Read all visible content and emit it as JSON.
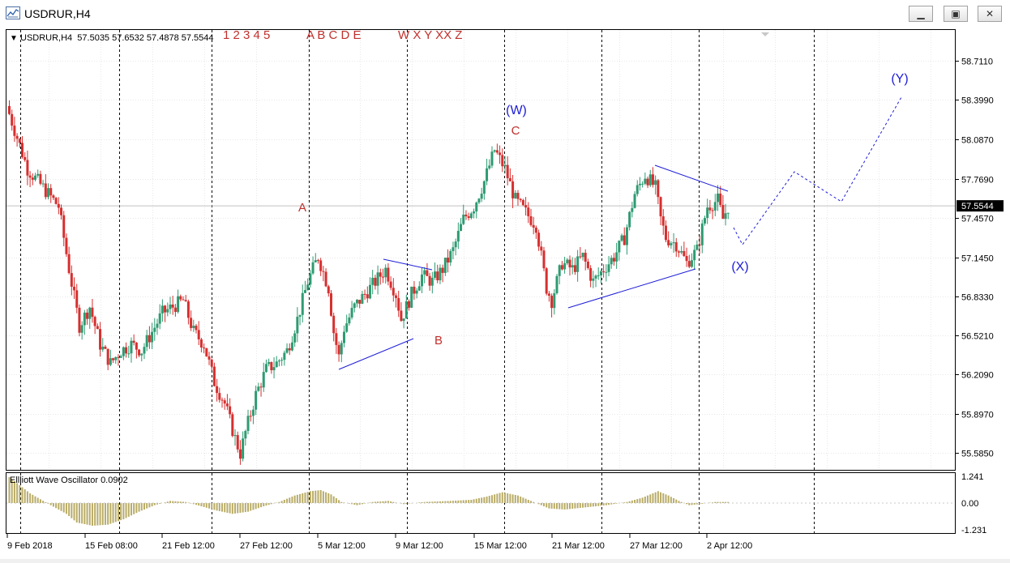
{
  "window": {
    "title": "USDRUR,H4",
    "icon": "chart-window-icon",
    "buttons": {
      "minimize": "minimize-icon",
      "restore": "restore-icon",
      "close": "close-icon"
    }
  },
  "chart_header": {
    "marker": "▼",
    "text": "USDRUR,H4  57.5035 57.6532 57.4878 57.5544"
  },
  "wave_toolbar": {
    "numbers": "1 2 3 4 5",
    "letters": "A B C D E",
    "combo": "W X Y XX Z"
  },
  "colors": {
    "bull": "#2e9b72",
    "bear": "#d62f2f",
    "wave_red": "#c0302c",
    "wave_blue": "#1c1cd8",
    "oscillator": "#b9ac66",
    "grid": "#c8c8c8"
  },
  "chart_data": {
    "type": "candlestick",
    "symbol": "USDRUR",
    "timeframe": "H4",
    "ylim": [
      55.45,
      58.95
    ],
    "y_ticks": [
      "58.7110",
      "58.3990",
      "58.0870",
      "57.7690",
      "57.4570",
      "57.1450",
      "56.8330",
      "56.5210",
      "56.2090",
      "55.8970",
      "55.5850"
    ],
    "current_price": "57.5544",
    "x_ticks": [
      "9 Feb 2018",
      "15 Feb 08:00",
      "21 Feb 12:00",
      "27 Feb 12:00",
      "5 Mar 12:00",
      "9 Mar 12:00",
      "15 Mar 12:00",
      "21 Mar 12:00",
      "27 Mar 12:00",
      "2 Apr 12:00"
    ],
    "close_path": [
      [
        0,
        58.35
      ],
      [
        4,
        58.1
      ],
      [
        8,
        57.85
      ],
      [
        12,
        57.75
      ],
      [
        16,
        57.65
      ],
      [
        20,
        57.55
      ],
      [
        24,
        57.05
      ],
      [
        28,
        56.6
      ],
      [
        32,
        56.75
      ],
      [
        36,
        56.45
      ],
      [
        40,
        56.3
      ],
      [
        44,
        56.4
      ],
      [
        48,
        56.45
      ],
      [
        52,
        56.4
      ],
      [
        56,
        56.55
      ],
      [
        60,
        56.7
      ],
      [
        64,
        56.75
      ],
      [
        68,
        56.8
      ],
      [
        72,
        56.55
      ],
      [
        76,
        56.45
      ],
      [
        80,
        56.15
      ],
      [
        84,
        55.98
      ],
      [
        88,
        55.7
      ],
      [
        90,
        55.58
      ],
      [
        92,
        55.75
      ],
      [
        96,
        56.05
      ],
      [
        100,
        56.25
      ],
      [
        104,
        56.3
      ],
      [
        108,
        56.4
      ],
      [
        112,
        56.65
      ],
      [
        116,
        56.95
      ],
      [
        120,
        57.15
      ],
      [
        124,
        56.9
      ],
      [
        126,
        56.55
      ],
      [
        128,
        56.35
      ],
      [
        130,
        56.58
      ],
      [
        134,
        56.75
      ],
      [
        138,
        56.85
      ],
      [
        142,
        56.95
      ],
      [
        146,
        57.05
      ],
      [
        150,
        56.85
      ],
      [
        152,
        56.65
      ],
      [
        156,
        56.85
      ],
      [
        160,
        57.0
      ],
      [
        164,
        56.95
      ],
      [
        168,
        57.05
      ],
      [
        172,
        57.2
      ],
      [
        176,
        57.45
      ],
      [
        180,
        57.55
      ],
      [
        184,
        57.75
      ],
      [
        188,
        58.0
      ],
      [
        192,
        57.85
      ],
      [
        196,
        57.6
      ],
      [
        200,
        57.5
      ],
      [
        204,
        57.4
      ],
      [
        208,
        56.9
      ],
      [
        210,
        56.8
      ],
      [
        214,
        57.1
      ],
      [
        218,
        57.05
      ],
      [
        222,
        57.15
      ],
      [
        226,
        56.95
      ],
      [
        230,
        57.05
      ],
      [
        234,
        57.15
      ],
      [
        238,
        57.3
      ],
      [
        242,
        57.65
      ],
      [
        246,
        57.8
      ],
      [
        250,
        57.7
      ],
      [
        252,
        57.45
      ],
      [
        254,
        57.3
      ],
      [
        258,
        57.25
      ],
      [
        262,
        57.1
      ],
      [
        266,
        57.2
      ],
      [
        270,
        57.55
      ],
      [
        274,
        57.6
      ],
      [
        276,
        57.45
      ],
      [
        278,
        57.55
      ]
    ],
    "oscillator": {
      "label": "Ellliott Wave Oscillator 0.0902",
      "y_ticks": [
        "1.241",
        "0.00",
        "-1.231"
      ],
      "ylim": [
        -1.35,
        1.35
      ],
      "path": [
        [
          0,
          1.2
        ],
        [
          8,
          0.45
        ],
        [
          16,
          -0.1
        ],
        [
          22,
          -0.5
        ],
        [
          26,
          -0.9
        ],
        [
          32,
          -1.05
        ],
        [
          38,
          -1.0
        ],
        [
          44,
          -0.75
        ],
        [
          50,
          -0.4
        ],
        [
          56,
          -0.1
        ],
        [
          62,
          0.1
        ],
        [
          68,
          0.05
        ],
        [
          74,
          -0.15
        ],
        [
          80,
          -0.35
        ],
        [
          86,
          -0.5
        ],
        [
          92,
          -0.4
        ],
        [
          98,
          -0.15
        ],
        [
          104,
          0.05
        ],
        [
          110,
          0.35
        ],
        [
          116,
          0.55
        ],
        [
          120,
          0.6
        ],
        [
          124,
          0.4
        ],
        [
          128,
          0.05
        ],
        [
          134,
          -0.1
        ],
        [
          140,
          0.05
        ],
        [
          146,
          0.1
        ],
        [
          152,
          -0.05
        ],
        [
          160,
          0.05
        ],
        [
          170,
          0.1
        ],
        [
          178,
          0.15
        ],
        [
          184,
          0.3
        ],
        [
          190,
          0.5
        ],
        [
          196,
          0.35
        ],
        [
          202,
          0.05
        ],
        [
          208,
          -0.25
        ],
        [
          214,
          -0.3
        ],
        [
          222,
          -0.2
        ],
        [
          230,
          -0.1
        ],
        [
          238,
          0.05
        ],
        [
          244,
          0.25
        ],
        [
          250,
          0.55
        ],
        [
          254,
          0.35
        ],
        [
          258,
          0.1
        ],
        [
          262,
          -0.1
        ],
        [
          266,
          -0.05
        ],
        [
          272,
          0.05
        ],
        [
          278,
          0.05
        ]
      ],
      "count": 278
    },
    "wave_labels": {
      "A": "A",
      "B": "B",
      "C": "C",
      "W": "(W)",
      "X": "(X)",
      "Y": "(Y)"
    }
  }
}
